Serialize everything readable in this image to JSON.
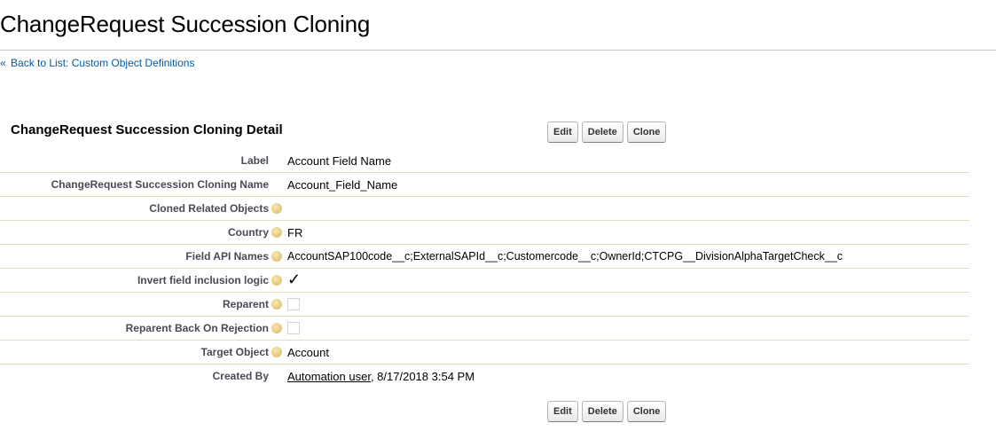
{
  "page": {
    "title": "ChangeRequest Succession Cloning",
    "back_link_prefix": "«",
    "back_link": "Back to List: Custom Object Definitions"
  },
  "detail": {
    "section_title": "ChangeRequest Succession Cloning Detail",
    "buttons": {
      "edit": "Edit",
      "delete": "Delete",
      "clone": "Clone"
    },
    "fields": {
      "label": {
        "label": "Label",
        "value": "Account Field Name"
      },
      "name": {
        "label": "ChangeRequest Succession Cloning Name",
        "value": "Account_Field_Name"
      },
      "cloned_related_objects": {
        "label": "Cloned Related Objects",
        "value": ""
      },
      "country": {
        "label": "Country",
        "value": "FR"
      },
      "field_api_names": {
        "label": "Field API Names",
        "value": "AccountSAP100code__c;ExternalSAPId__c;Customercode__c;OwnerId;CTCPG__DivisionAlphaTargetCheck__c"
      },
      "invert_logic": {
        "label": "Invert field inclusion logic",
        "value": "✓",
        "checked": true
      },
      "reparent": {
        "label": "Reparent",
        "checked": false
      },
      "reparent_back": {
        "label": "Reparent Back On Rejection",
        "checked": false
      },
      "target_object": {
        "label": "Target Object",
        "value": "Account"
      },
      "created_by": {
        "label": "Created By",
        "user": "Automation user",
        "date": ", 8/17/2018 3:54 PM"
      }
    }
  },
  "colors": {
    "link": "#015ba7",
    "label_text": "#4a4a56",
    "row_border": "#e3deb8",
    "help_icon": "#d8b760"
  },
  "icons": {
    "help": "help-icon",
    "back": "double-left-arrow"
  }
}
